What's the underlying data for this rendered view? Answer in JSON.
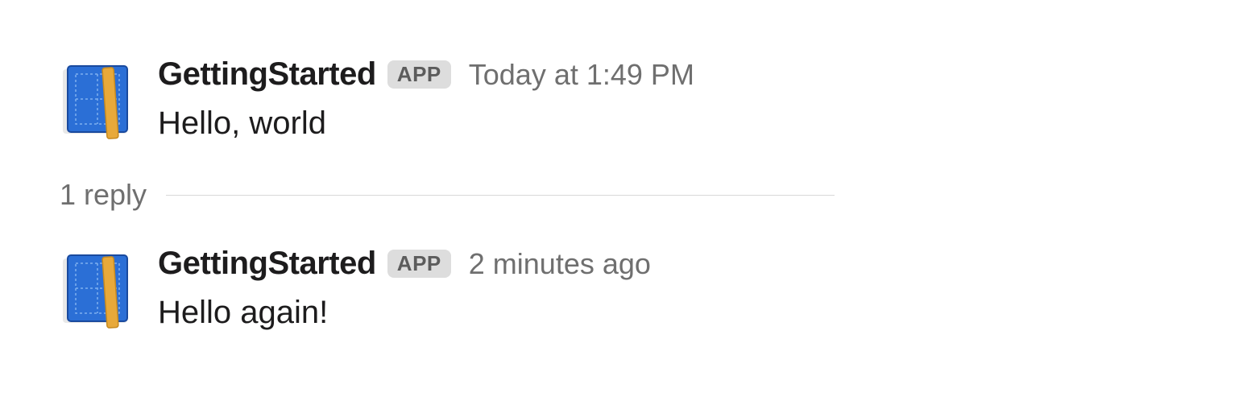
{
  "messages": [
    {
      "sender": "GettingStarted",
      "badge": "APP",
      "timestamp": "Today at 1:49 PM",
      "text": "Hello, world"
    },
    {
      "sender": "GettingStarted",
      "badge": "APP",
      "timestamp": "2 minutes ago",
      "text": "Hello again!"
    }
  ],
  "thread": {
    "reply_count": "1 reply"
  }
}
